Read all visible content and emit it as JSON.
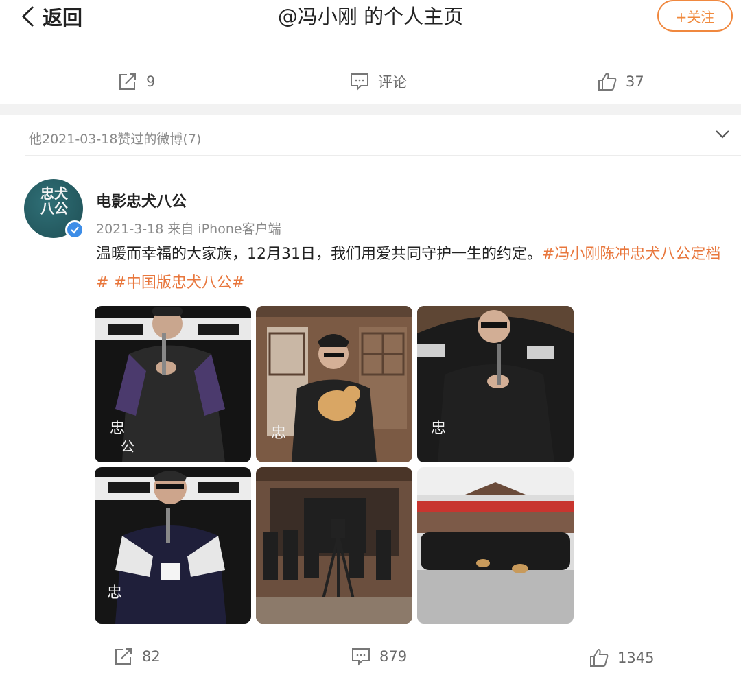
{
  "header": {
    "back_label": "返回",
    "title": "@冯小刚 的个人主页",
    "follow_label": "+关注"
  },
  "top_post_actions": {
    "repost": "9",
    "comment": "评论",
    "like": "37"
  },
  "liked_section": {
    "label": "他2021-03-18赞过的微博(7)"
  },
  "post": {
    "author": "电影忠犬八公",
    "avatar_text": "忠犬八公",
    "time": "2021-3-18",
    "source": "来自 iPhone客户端",
    "text_plain": "温暖而幸福的大家族，12月31日，我们用爱共同守护一生的约定。",
    "hashtag1": "#冯小刚陈冲忠犬八公定档#",
    "hashtag2": "#中国版忠犬八公#",
    "photos": [
      {
        "name": "photo-speaker-purple-sleeves"
      },
      {
        "name": "photo-man-holding-dog"
      },
      {
        "name": "photo-speaker-glasses"
      },
      {
        "name": "photo-speaker-white-sleeves"
      },
      {
        "name": "photo-crew-with-camera"
      },
      {
        "name": "photo-group-photo"
      }
    ],
    "actions": {
      "repost": "82",
      "comment": "879",
      "like": "1345"
    }
  },
  "colors": {
    "accent": "#e8773d",
    "verified": "#3d8de7"
  }
}
